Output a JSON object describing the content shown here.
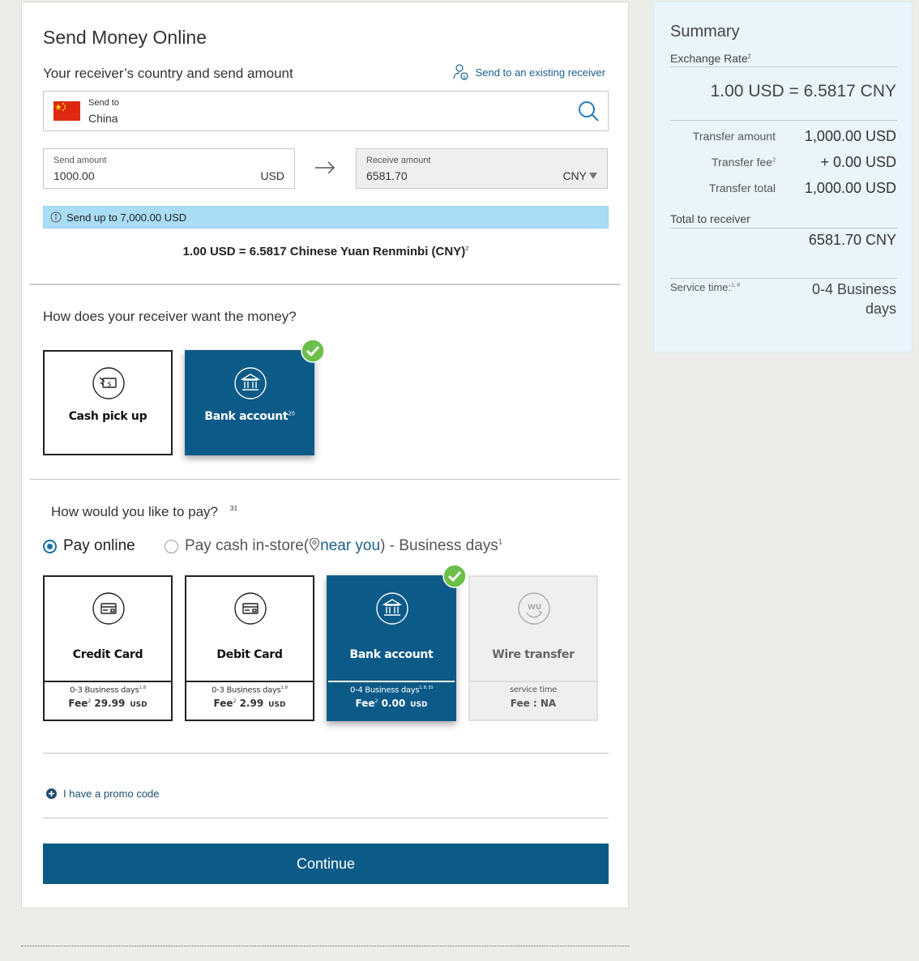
{
  "page": {
    "title": "Send Money Online"
  },
  "receiver_section": {
    "label": "Your receiver’s country and send amount",
    "existing_link": "Send to an existing receiver",
    "send_to_label": "Send to",
    "send_to_value": "China"
  },
  "amounts": {
    "send_label": "Send amount",
    "send_value": "1000.00",
    "send_currency": "USD",
    "receive_label": "Receive amount",
    "receive_value": "6581.70",
    "receive_currency": "CNY"
  },
  "info_bar": {
    "text": "Send up to 7,000.00 USD"
  },
  "rate_line": {
    "text": "1.00 USD = 6.5817 Chinese Yuan Renminbi (CNY)",
    "sup": "2"
  },
  "receive_method": {
    "question": "How does your receiver want the money?",
    "options": [
      {
        "label": "Cash pick up",
        "sup": "",
        "icon": "cash-pickup-icon",
        "selected": false
      },
      {
        "label": "Bank account",
        "sup": "20",
        "icon": "bank-icon",
        "selected": true
      }
    ]
  },
  "pay_method": {
    "question": "How would you like to pay?",
    "question_sup": "31",
    "radio_online": "Pay online",
    "radio_cash_prefix": "Pay cash in-store(",
    "radio_cash_near": "near you",
    "radio_cash_suffix": ") - Business days",
    "radio_cash_sup": "1",
    "options": [
      {
        "label": "Credit Card",
        "days": "0-3 Business days",
        "days_sup": "1, 8",
        "fee_label": "Fee",
        "fee_sup": "2",
        "fee": "29.99",
        "fee_cur": "USD",
        "icon": "card-icon",
        "state": "normal"
      },
      {
        "label": "Debit Card",
        "days": "0-3 Business days",
        "days_sup": "1, 8",
        "fee_label": "Fee",
        "fee_sup": "2",
        "fee": "2.99",
        "fee_cur": "USD",
        "icon": "card-icon",
        "state": "normal"
      },
      {
        "label": "Bank account",
        "days": "0-4 Business days",
        "days_sup": "1, 8, 33",
        "fee_label": "Fee",
        "fee_sup": "2",
        "fee": "0.00",
        "fee_cur": "USD",
        "icon": "bank-icon",
        "state": "selected"
      },
      {
        "label": "Wire transfer",
        "days": "service time",
        "fee_text": "Fee : NA",
        "icon": "wu-icon",
        "state": "disabled"
      }
    ]
  },
  "promo": {
    "text": "I have a promo code"
  },
  "continue_button": "Continue",
  "summary": {
    "title": "Summary",
    "exchange_rate_label": "Exchange Rate",
    "exchange_rate_sup": "2",
    "exchange_rate_value": "1.00 USD = 6.5817 CNY",
    "transfer_amount_label": "Transfer amount",
    "transfer_amount_value": "1,000.00 USD",
    "transfer_fee_label": "Transfer fee",
    "transfer_fee_sup": "2",
    "transfer_fee_value": "+ 0.00 USD",
    "transfer_total_label": "Transfer total",
    "transfer_total_value": "1,000.00 USD",
    "total_receiver_label": "Total  to receiver",
    "total_receiver_value": "6581.70 CNY",
    "service_time_label": "Service time:",
    "service_time_sup": "1, 8",
    "service_time_value": "0-4 Business days"
  },
  "colors": {
    "brand_blue": "#0c5a87",
    "check_green": "#6cc04a",
    "info_blue": "#a9ddf5",
    "summary_bg": "#eaf5fb"
  }
}
